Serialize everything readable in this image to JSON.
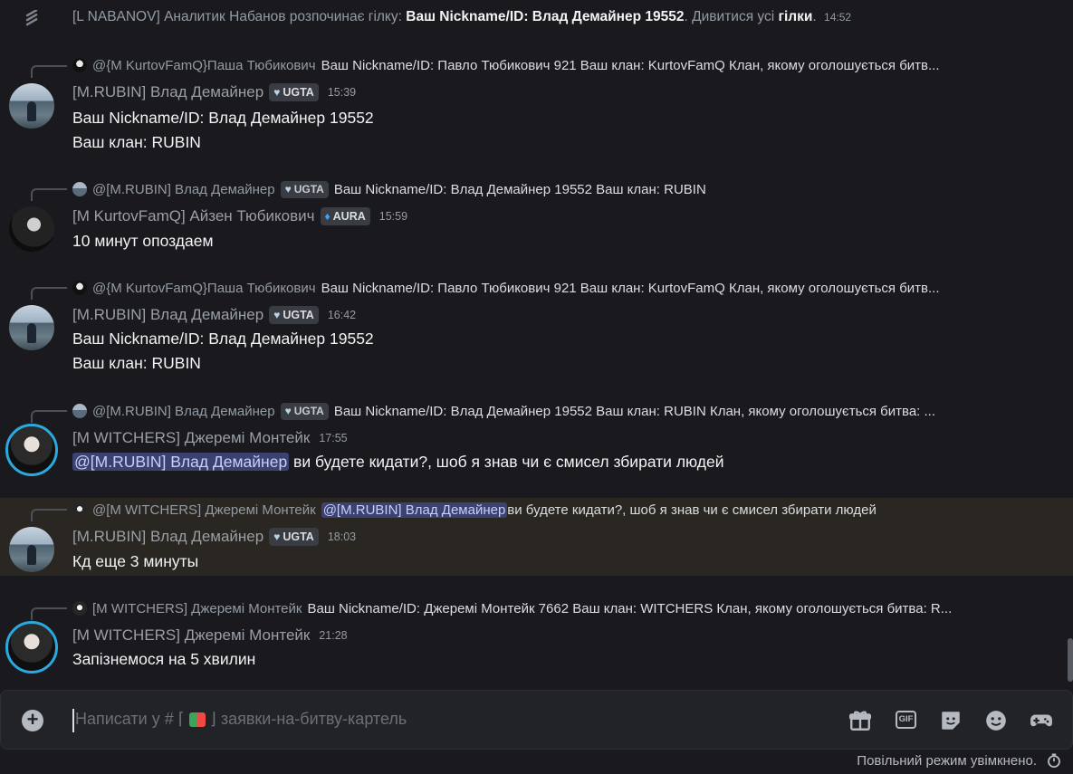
{
  "system_message": {
    "prefix": "[L NABANOV] Аналитик Набанов розпочинає гілку: ",
    "thread_name": "Ваш Nickname/ID: Влад Демайнер 19552",
    "mid": ". Дивитися усі ",
    "link": "гілки",
    "suffix": ".",
    "time": "14:52"
  },
  "messages": [
    {
      "reply_name": "@{M KurtovFamQ}Паша Тюбикович",
      "reply_tag": "",
      "reply_text": "Ваш Nickname/ID: Павло Тюбикович 921 Ваш клан: KurtovFamQ  Клан, якому оголошується битв...",
      "author": "[M.RUBIN] Влад Демайнер",
      "tag": "UGTA",
      "time": "15:39",
      "line1": "Ваш Nickname/ID: Влад Демайнер 19552",
      "line2": "Ваш клан:  RUBIN"
    },
    {
      "reply_name": "@[M.RUBIN] Влад Демайнер",
      "reply_tag": "UGTA",
      "reply_text": "Ваш Nickname/ID: Влад Демайнер 19552 Ваш клан:  RUBIN",
      "author": "[M KurtovFamQ] Айзен Тюбикович",
      "tag": "AURA",
      "time": "15:59",
      "line1": "10 минут опоздаем"
    },
    {
      "reply_name": "@{M KurtovFamQ}Паша Тюбикович",
      "reply_text": "Ваш Nickname/ID: Павло Тюбикович 921 Ваш клан: KurtovFamQ  Клан, якому оголошується битв...",
      "author": "[M.RUBIN] Влад Демайнер",
      "tag": "UGTA",
      "time": "16:42",
      "line1": "Ваш Nickname/ID: Влад Демайнер 19552",
      "line2": "Ваш клан:  RUBIN"
    },
    {
      "reply_name": "@[M.RUBIN] Влад Демайнер",
      "reply_tag": "UGTA",
      "reply_text": "Ваш Nickname/ID: Влад Демайнер 19552 Ваш клан: RUBIN Клан, якому оголошується битва:  ...",
      "author": "[M WITCHERS] Джеремі Монтейк",
      "time": "17:55",
      "mention": "@[M.RUBIN] Влад Демайнер",
      "line1": " ви будете кидати?, шоб я знав чи є смисел збирати людей"
    },
    {
      "reply_name": "@[M WITCHERS] Джеремі Монтейк",
      "reply_mention": "@[M.RUBIN] Влад Демайнер",
      "reply_text": " ви будете кидати?, шоб я знав чи є смисел збирати людей",
      "author": "[M.RUBIN] Влад Демайнер",
      "tag": "UGTA",
      "time": "18:03",
      "line1": "Кд еще 3 минуты"
    },
    {
      "reply_name": "[M WITCHERS] Джеремі Монтейк",
      "reply_text": "Ваш Nickname/ID: Джеремі Монтейк 7662 Ваш клан: WITCHERS Клан, якому оголошується битва:  R...",
      "author": "[M WITCHERS] Джеремі Монтейк",
      "time": "21:28",
      "line1": "Запізнемося на 5 хвилин"
    }
  ],
  "composer": {
    "placeholder_prefix": "Написати у # ⌈",
    "placeholder_suffix": "⌋ заявки-на-битву-картель"
  },
  "footer": {
    "slow_mode": "Повільний режим увімкнено."
  },
  "colors": {
    "background": "#1a1a1e",
    "mention_bg": "#3c4270",
    "highlight_bg": "#2a2621",
    "avatar_ring": "#2aa9e0"
  },
  "icons": [
    "thread-icon",
    "plus-icon",
    "gift-icon",
    "gif-icon",
    "sticker-icon",
    "emoji-icon",
    "activity-icon",
    "timer-icon"
  ]
}
